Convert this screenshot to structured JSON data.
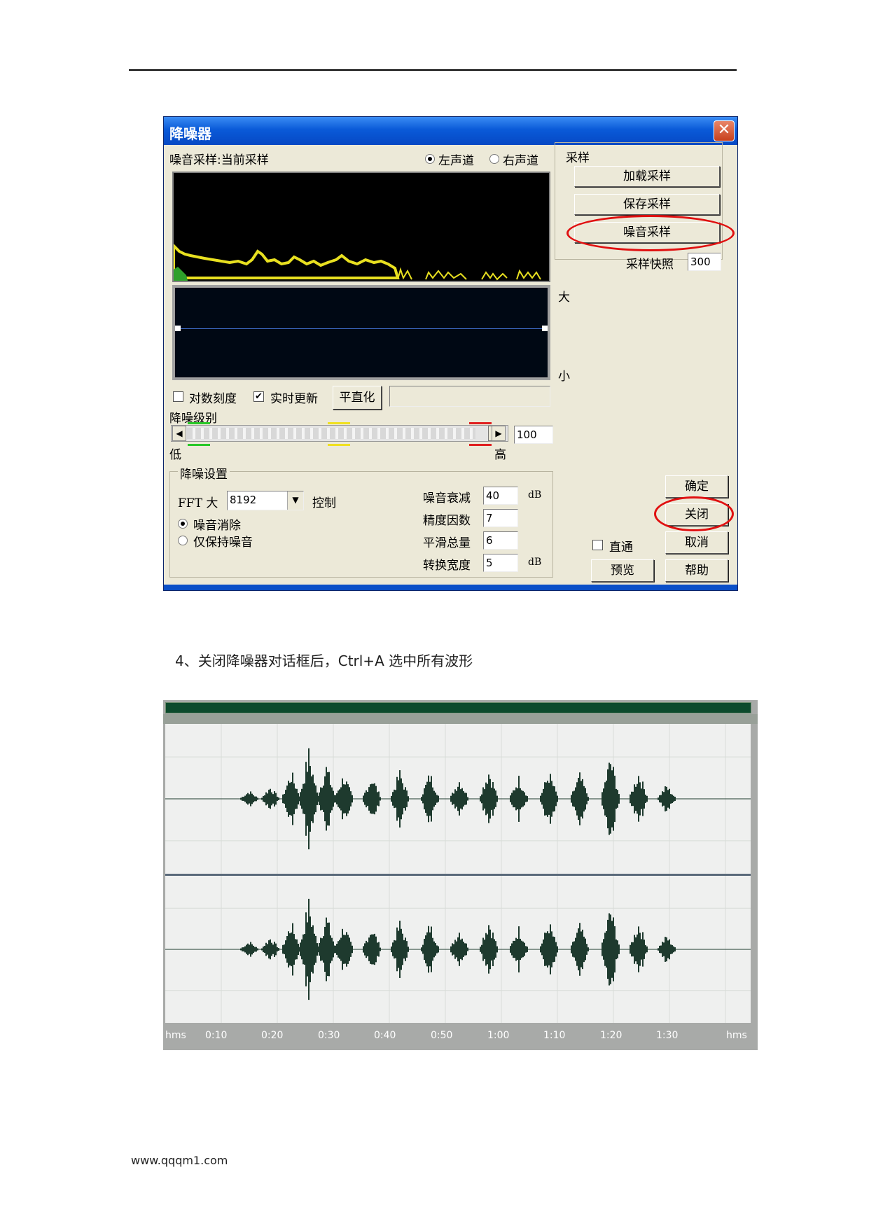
{
  "dialog": {
    "title": "降噪器",
    "close_glyph": "✕",
    "noise_sample_label": "噪音采样:当前采样",
    "channel_left": "左声道",
    "channel_right": "右声道",
    "sample_group": "采样",
    "load_sample": "加载采样",
    "save_sample": "保存采样",
    "noise_sample": "噪音采样",
    "snapshot_label": "采样快照",
    "snapshot_value": "300",
    "big_label": "大",
    "small_label": "小",
    "log_scale": "对数刻度",
    "live_update": "实时更新",
    "live_update_checked": true,
    "flatten": "平直化",
    "noise_level_label": "降噪级别",
    "noise_level_value": "100",
    "low_label": "低",
    "high_label": "高",
    "settings_group": "降噪设置",
    "fft_label": "FFT 大",
    "fft_value": "8192",
    "control": "控制",
    "remove_noise": "噪音消除",
    "keep_noise_only": "仅保持噪音",
    "attenuation_label": "噪音衰减",
    "attenuation_value": "40",
    "precision_label": "精度因数",
    "precision_value": "7",
    "smoothing_label": "平滑总量",
    "smoothing_value": "6",
    "transition_label": "转换宽度",
    "transition_value": "5",
    "db_unit": "dB",
    "ok": "确定",
    "close": "关闭",
    "cancel": "取消",
    "help": "帮助",
    "bypass": "直通",
    "preview": "预览",
    "highlight_color": "#e01010",
    "spectrum_color": "#e8e020"
  },
  "caption": "4、关闭降噪器对话框后，Ctrl+A 选中所有波形",
  "waveform": {
    "time_labels": [
      "hms",
      "0:10",
      "0:20",
      "0:30",
      "0:40",
      "0:50",
      "1:00",
      "1:10",
      "1:20",
      "1:30",
      "hms"
    ],
    "wave_color": "#1e3a2e"
  },
  "footer": "www.qqqm1.com"
}
